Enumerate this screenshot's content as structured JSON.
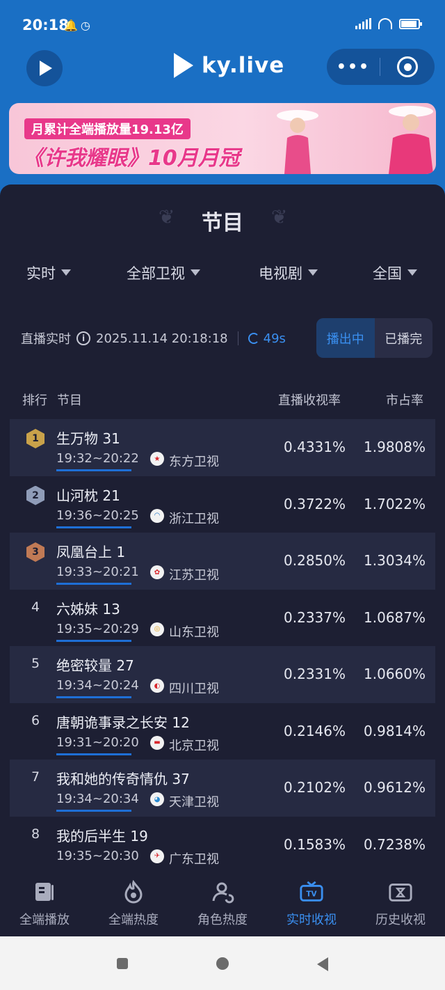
{
  "status_bar": {
    "time": "20:18"
  },
  "header": {
    "brand": "ky.live"
  },
  "banner": {
    "line1": "月累计全端播放量19.13亿",
    "line2": "《许我耀眼》10月月冠"
  },
  "card": {
    "title": "节目",
    "filters": [
      "实时",
      "全部卫视",
      "电视剧",
      "全国"
    ],
    "live_label": "直播实时",
    "timestamp": "2025.11.14 20:18:18",
    "refresh": "49s",
    "toggle": {
      "on_air": "播出中",
      "finished": "已播完"
    },
    "columns": {
      "rank": "排行",
      "program": "节目",
      "rating": "直播收视率",
      "share": "市占率"
    }
  },
  "rows": [
    {
      "rank": "1",
      "title": "生万物 31",
      "time": "19:32~20:22",
      "channel": "东方卫视",
      "rating": "0.4331%",
      "share": "1.9808%"
    },
    {
      "rank": "2",
      "title": "山河枕 21",
      "time": "19:36~20:25",
      "channel": "浙江卫视",
      "rating": "0.3722%",
      "share": "1.7022%"
    },
    {
      "rank": "3",
      "title": "凤凰台上 1",
      "time": "19:33~20:21",
      "channel": "江苏卫视",
      "rating": "0.2850%",
      "share": "1.3034%"
    },
    {
      "rank": "4",
      "title": "六姊妹 13",
      "time": "19:35~20:29",
      "channel": "山东卫视",
      "rating": "0.2337%",
      "share": "1.0687%"
    },
    {
      "rank": "5",
      "title": "绝密较量 27",
      "time": "19:34~20:24",
      "channel": "四川卫视",
      "rating": "0.2331%",
      "share": "1.0660%"
    },
    {
      "rank": "6",
      "title": "唐朝诡事录之长安 12",
      "time": "19:31~20:20",
      "channel": "北京卫视",
      "rating": "0.2146%",
      "share": "0.9814%"
    },
    {
      "rank": "7",
      "title": "我和她的传奇情仇 37",
      "time": "19:34~20:34",
      "channel": "天津卫视",
      "rating": "0.2102%",
      "share": "0.9612%"
    },
    {
      "rank": "8",
      "title": "我的后半生 19",
      "time": "19:35~20:30",
      "channel": "广东卫视",
      "rating": "0.1583%",
      "share": "0.7238%"
    }
  ],
  "colors": {
    "rank1": "#c9a24a",
    "rank2": "#8f9cb8",
    "rank3": "#c07a55",
    "ch_dongfang": "#d9262c",
    "ch_zhejiang": "#1a6fc4",
    "ch_jiangsu": "#d9262c",
    "ch_shandong": "#e6a520",
    "ch_sichuan": "#d9262c",
    "ch_beijing": "#d9262c",
    "ch_tianjin": "#2a8ad0",
    "ch_guangdong": "#d9262c"
  },
  "bottom_nav": [
    {
      "label": "全端播放",
      "icon": "book-icon"
    },
    {
      "label": "全端热度",
      "icon": "flame-icon"
    },
    {
      "label": "角色热度",
      "icon": "user-refresh-icon"
    },
    {
      "label": "实时收视",
      "icon": "tv-icon",
      "active": true
    },
    {
      "label": "历史收视",
      "icon": "history-tv-icon"
    }
  ]
}
